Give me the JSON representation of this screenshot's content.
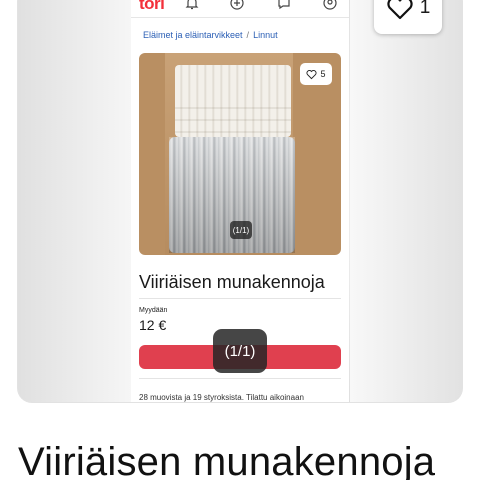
{
  "header": {
    "logo_text": "tori",
    "nav_icons": [
      "bell-icon",
      "plus-circle-icon",
      "chat-icon",
      "user-icon"
    ]
  },
  "breadcrumb": {
    "items": [
      "Eläimet ja eläintarvikkeet",
      "Linnut"
    ],
    "separator": "/"
  },
  "listing": {
    "photo_like_count": "5",
    "photo_counter": "(1/1)",
    "title": "Viiriäisen munakennoja",
    "status_label": "Myydään",
    "price": "12 €",
    "description_start": "28 muovista ja 19 styroksista. Tilattu aikoinaan"
  },
  "overlay": {
    "image_counter": "(1/1)",
    "like_count": "1"
  },
  "page_title": "Viiriäisen munakennoja",
  "colors": {
    "brand": "#f3303a",
    "cta": "#e0404f",
    "link": "#2b5fb5"
  }
}
